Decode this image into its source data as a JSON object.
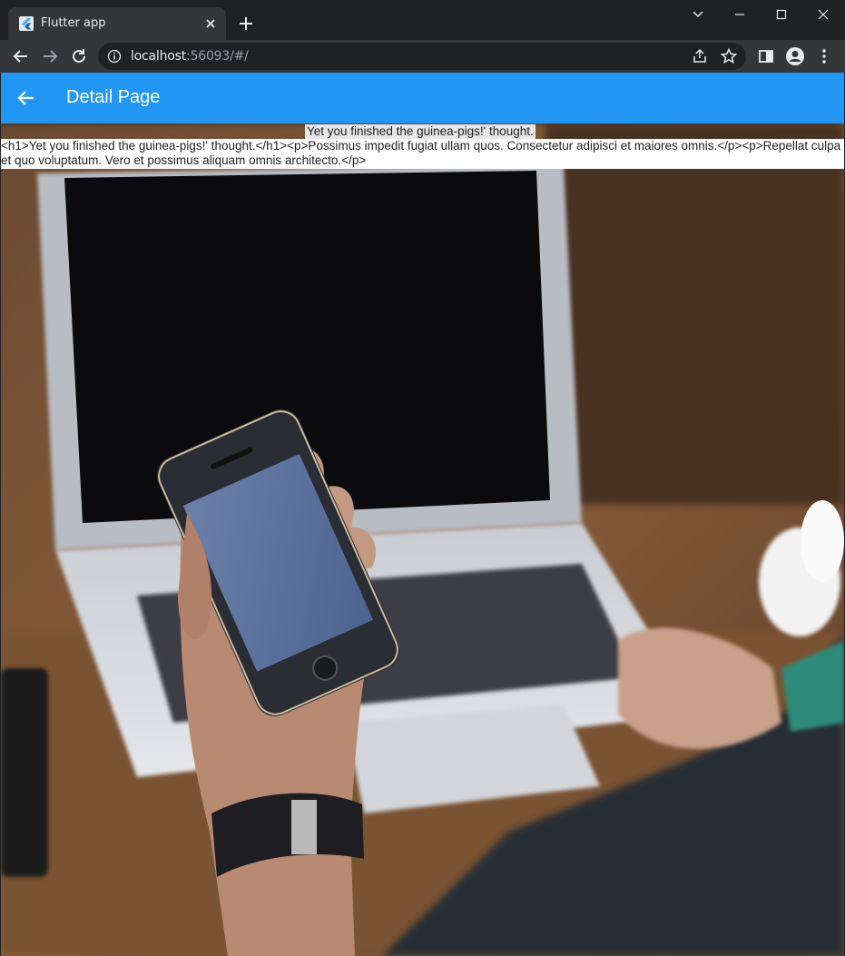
{
  "browser": {
    "tab_title": "Flutter app",
    "url_host": "localhost",
    "url_rest": ":56093/#/"
  },
  "appbar": {
    "title": "Detail Page",
    "color": "#2196f3"
  },
  "content": {
    "heading": "Yet you finished the guinea-pigs!' thought.",
    "raw_html": "<h1>Yet you finished the guinea-pigs!' thought.</h1><p>Possimus impedit fugiat ullam quos. Consectetur adipisci et maiores omnis.</p><p>Repellat culpa et quo voluptatum. Vero et possimus aliquam omnis architecto.</p>"
  },
  "icons": {
    "favicon": "flutter-logo-icon",
    "tab_close": "close-icon",
    "new_tab": "plus-icon",
    "minimize": "minimize-icon",
    "maximize": "maximize-icon",
    "close_window": "close-icon",
    "chevron": "chevron-down-icon",
    "back": "arrow-left-icon",
    "forward": "arrow-right-icon",
    "reload": "reload-icon",
    "info": "info-icon",
    "share": "share-icon",
    "bookmark": "star-icon",
    "side_panel": "side-panel-icon",
    "profile": "profile-icon",
    "menu": "more-vert-icon",
    "app_back": "arrow-back-icon"
  }
}
